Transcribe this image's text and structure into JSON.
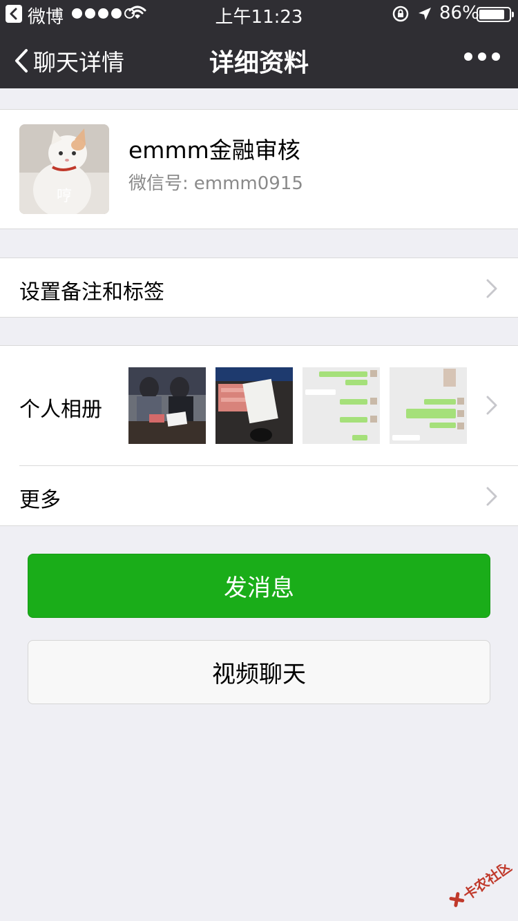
{
  "status_bar": {
    "source_app": "微博",
    "time": "上午11:23",
    "battery_text": "86%",
    "battery_level": 0.86
  },
  "nav": {
    "back_label": "聊天详情",
    "title": "详细资料"
  },
  "profile": {
    "nickname": "emmm金融审核",
    "wechat_id_label": "微信号:",
    "wechat_id": "emmm0915",
    "avatar_caption": "哼"
  },
  "rows": {
    "remark_label": "设置备注和标签",
    "album_label": "个人相册",
    "more_label": "更多"
  },
  "buttons": {
    "send_message": "发消息",
    "video_chat": "视频聊天"
  },
  "watermark_text": "卡农社区",
  "colors": {
    "header_bg": "#2f2e33",
    "page_bg": "#efeff4",
    "primary_green": "#1aad19"
  }
}
